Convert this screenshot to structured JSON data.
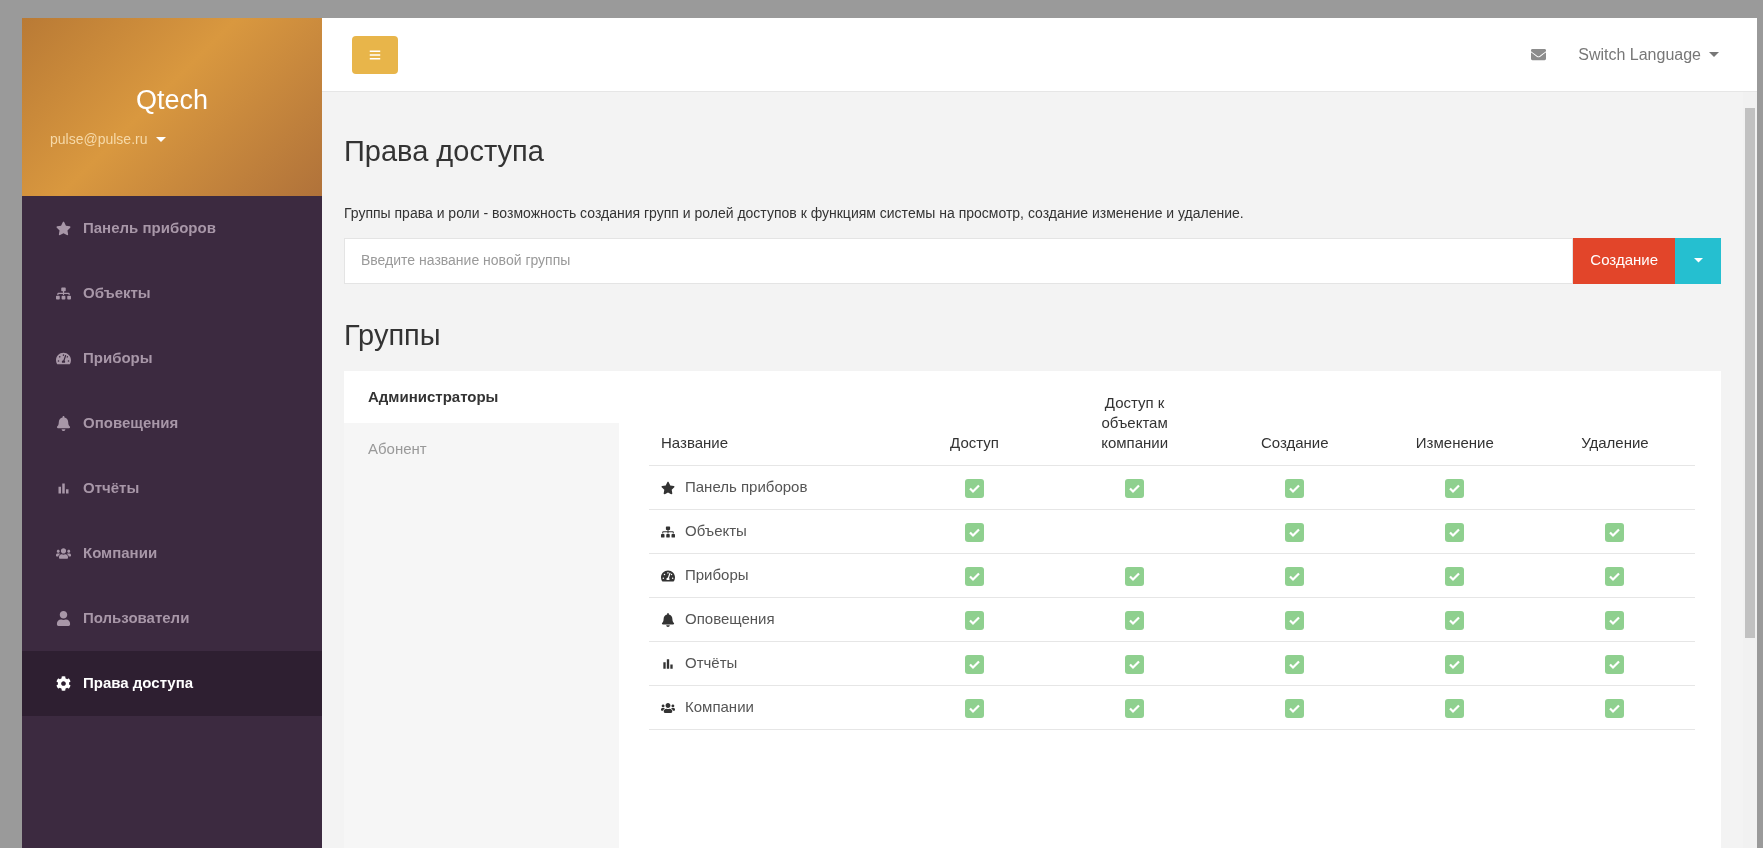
{
  "sidebar": {
    "brand": "Qtech",
    "user": "pulse@pulse.ru",
    "items": [
      {
        "label": "Панель приборов",
        "selected": false
      },
      {
        "label": "Объекты",
        "selected": false
      },
      {
        "label": "Приборы",
        "selected": false
      },
      {
        "label": "Оповещения",
        "selected": false
      },
      {
        "label": "Отчёты",
        "selected": false
      },
      {
        "label": "Компании",
        "selected": false
      },
      {
        "label": "Пользователи",
        "selected": false
      },
      {
        "label": "Права доступа",
        "selected": true
      }
    ]
  },
  "header": {
    "language": "Switch Language"
  },
  "page": {
    "title": "Права доступа",
    "description": "Группы права и роли - возможность создания групп и ролей доступов к функциям системы на просмотр, создание изменение и удаление.",
    "group_field": {
      "placeholder": "Введите название новой группы"
    },
    "create_button": "Создание",
    "groups_title": "Группы"
  },
  "group_tabs": [
    {
      "label": "Администраторы",
      "selected": true
    },
    {
      "label": "Абонент",
      "selected": false
    }
  ],
  "table": {
    "columns": [
      "Название",
      "Доступ",
      "Доступ к объектам компании",
      "Создание",
      "Изменение",
      "Удаление"
    ],
    "rows": [
      {
        "name": "Панель приборов",
        "cells": [
          {
            "checked": true
          },
          {
            "checked": true
          },
          {
            "checked": true
          },
          {
            "checked": true
          },
          {
            "checked": false
          }
        ]
      },
      {
        "name": "Объекты",
        "cells": [
          {
            "checked": true
          },
          {
            "checked": false
          },
          {
            "checked": true
          },
          {
            "checked": true
          },
          {
            "checked": true
          }
        ]
      },
      {
        "name": "Приборы",
        "cells": [
          {
            "checked": true
          },
          {
            "checked": true
          },
          {
            "checked": true
          },
          {
            "checked": true
          },
          {
            "checked": true
          }
        ]
      },
      {
        "name": "Оповещения",
        "cells": [
          {
            "checked": true
          },
          {
            "checked": true
          },
          {
            "checked": true
          },
          {
            "checked": true
          },
          {
            "checked": true
          }
        ]
      },
      {
        "name": "Отчёты",
        "cells": [
          {
            "checked": true
          },
          {
            "checked": true
          },
          {
            "checked": true
          },
          {
            "checked": true
          },
          {
            "checked": true
          }
        ]
      },
      {
        "name": "Компании",
        "cells": [
          {
            "checked": true
          },
          {
            "checked": true
          },
          {
            "checked": true
          },
          {
            "checked": true
          },
          {
            "checked": true
          }
        ]
      }
    ]
  }
}
